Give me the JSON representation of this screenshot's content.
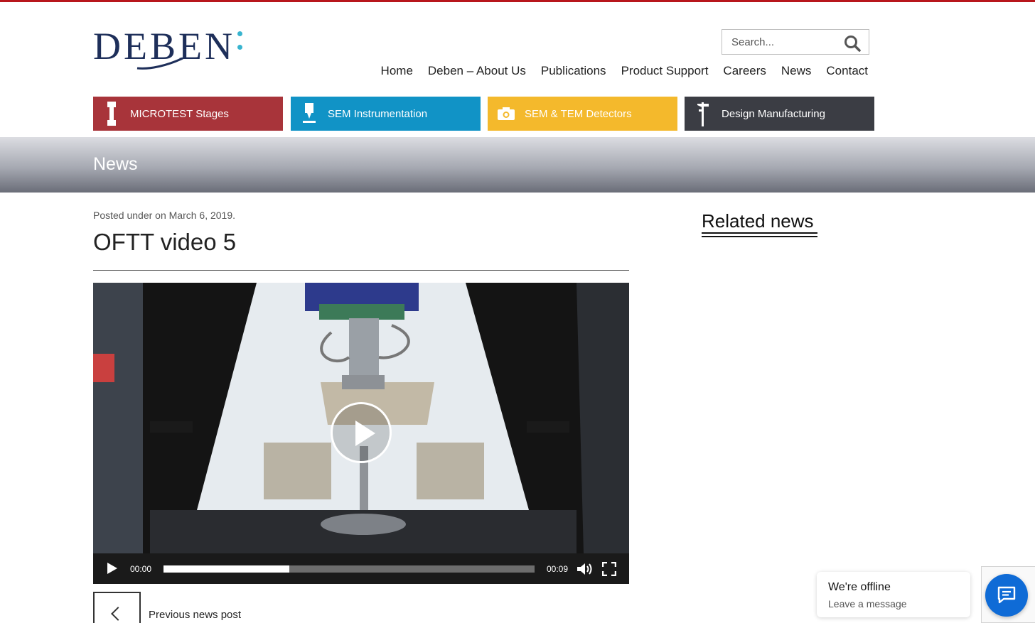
{
  "brand": {
    "logo_text": "DEBEN",
    "accent": "#b8171c",
    "logo_color": "#1e2f5a",
    "dot_color": "#38b4cf"
  },
  "search": {
    "placeholder": "Search...",
    "icon": "search-icon"
  },
  "nav": {
    "items": [
      {
        "label": "Home"
      },
      {
        "label": "Deben – About Us"
      },
      {
        "label": "Publications"
      },
      {
        "label": "Product Support"
      },
      {
        "label": "Careers"
      },
      {
        "label": "News"
      },
      {
        "label": "Contact"
      }
    ]
  },
  "categories": [
    {
      "label": "MICROTEST Stages",
      "color": "#a8343a",
      "icon": "tensile-specimen-icon"
    },
    {
      "label": "SEM Instrumentation",
      "color": "#1193c6",
      "icon": "microscope-icon"
    },
    {
      "label": "SEM & TEM Detectors",
      "color": "#f4b92c",
      "icon": "camera-icon"
    },
    {
      "label": "Design Manufacturing",
      "color": "#3b3d44",
      "icon": "caliper-icon"
    }
  ],
  "banner": {
    "title": "News"
  },
  "post": {
    "meta": "Posted under on March 6, 2019.",
    "title": "OFTT video 5"
  },
  "video": {
    "current_time": "00:00",
    "duration": "00:09",
    "progress_fraction": 0.34
  },
  "pagination": {
    "previous_label": "Previous news post"
  },
  "sidebar": {
    "related_title": "Related news"
  },
  "chat": {
    "title": "We're offline",
    "subtitle": "Leave a message",
    "button_color": "#0f6bd6"
  }
}
